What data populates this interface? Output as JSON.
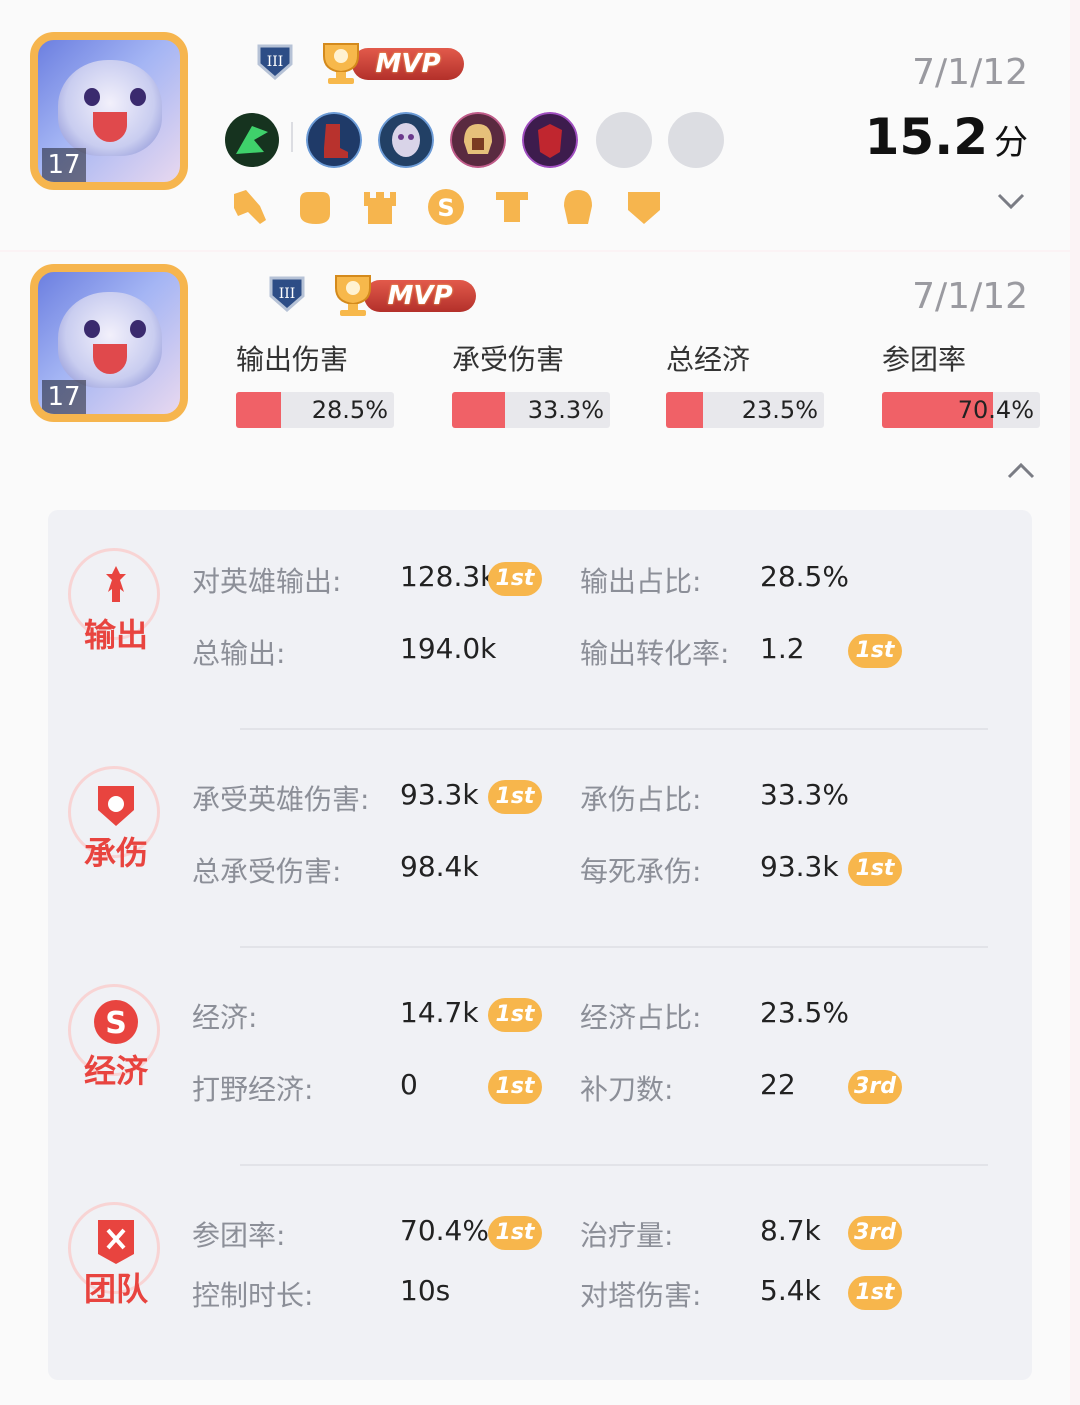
{
  "match1": {
    "level": "17",
    "kda": "7/1/12",
    "score": "15.2",
    "score_unit": "分",
    "mvp_label": "MVP",
    "colors": {
      "accent": "#f6b54e",
      "mvp": "#c9382f"
    }
  },
  "match2": {
    "level": "17",
    "kda": "7/1/12",
    "mvp_label": "MVP",
    "bars": [
      {
        "label": "输出伤害",
        "value": "28.5%",
        "fraction": 0.285
      },
      {
        "label": "承受伤害",
        "value": "33.3%",
        "fraction": 0.333
      },
      {
        "label": "总经济",
        "value": "23.5%",
        "fraction": 0.235
      },
      {
        "label": "参团率",
        "value": "70.4%",
        "fraction": 0.704
      }
    ]
  },
  "sections": [
    {
      "title": "输出",
      "icon": "sword-icon",
      "stats": [
        {
          "label": "对英雄输出:",
          "value": "128.3k",
          "rank": "1st"
        },
        {
          "label": "输出占比:",
          "value": "28.5%",
          "rank": ""
        },
        {
          "label": "总输出:",
          "value": "194.0k",
          "rank": ""
        },
        {
          "label": "输出转化率:",
          "value": "1.2",
          "rank": "1st"
        }
      ]
    },
    {
      "title": "承伤",
      "icon": "shield-icon",
      "stats": [
        {
          "label": "承受英雄伤害:",
          "value": "93.3k",
          "rank": "1st"
        },
        {
          "label": "承伤占比:",
          "value": "33.3%",
          "rank": ""
        },
        {
          "label": "总承受伤害:",
          "value": "98.4k",
          "rank": ""
        },
        {
          "label": "每死承伤:",
          "value": "93.3k",
          "rank": "1st"
        }
      ]
    },
    {
      "title": "经济",
      "icon": "coin-icon",
      "stats": [
        {
          "label": "经济:",
          "value": "14.7k",
          "rank": "1st"
        },
        {
          "label": "经济占比:",
          "value": "23.5%",
          "rank": ""
        },
        {
          "label": "打野经济:",
          "value": "0",
          "rank": "1st"
        },
        {
          "label": "补刀数:",
          "value": "22",
          "rank": "3rd"
        }
      ]
    },
    {
      "title": "团队",
      "icon": "team-banner-icon",
      "stats": [
        {
          "label": "参团率:",
          "value": "70.4%",
          "rank": "1st"
        },
        {
          "label": "治疗量:",
          "value": "8.7k",
          "rank": "3rd"
        },
        {
          "label": "控制时长:",
          "value": "10s",
          "rank": ""
        },
        {
          "label": "对塔伤害:",
          "value": "5.4k",
          "rank": "1st"
        }
      ]
    }
  ]
}
